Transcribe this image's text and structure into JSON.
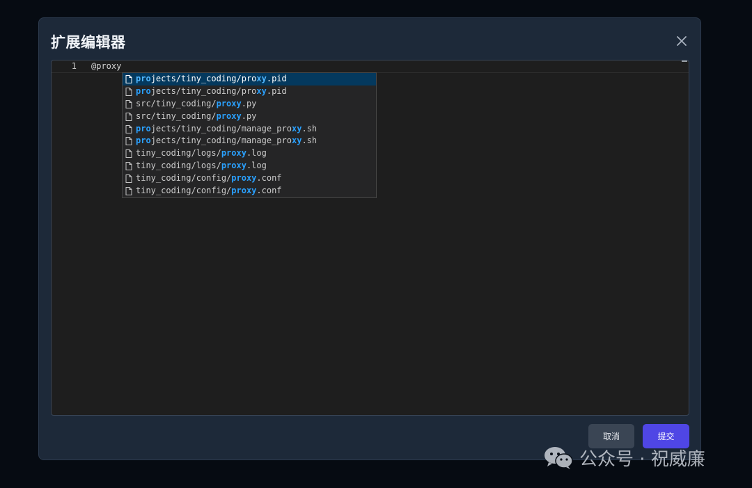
{
  "dialog": {
    "title": "扩展编辑器",
    "close_icon": "close-icon"
  },
  "editor": {
    "line_number": "1",
    "code": "@proxy"
  },
  "suggestions": [
    {
      "parts": [
        {
          "t": "pro",
          "h": true
        },
        {
          "t": "jects/tiny_coding/pro",
          "h": false
        },
        {
          "t": "xy",
          "h": true
        },
        {
          "t": ".pid",
          "h": false
        }
      ],
      "selected": true
    },
    {
      "parts": [
        {
          "t": "pro",
          "h": true
        },
        {
          "t": "jects/tiny_coding/pro",
          "h": false
        },
        {
          "t": "xy",
          "h": true
        },
        {
          "t": ".pid",
          "h": false
        }
      ],
      "selected": false
    },
    {
      "parts": [
        {
          "t": "src/tiny_coding/",
          "h": false
        },
        {
          "t": "proxy",
          "h": true
        },
        {
          "t": ".py",
          "h": false
        }
      ],
      "selected": false
    },
    {
      "parts": [
        {
          "t": "src/tiny_coding/",
          "h": false
        },
        {
          "t": "proxy",
          "h": true
        },
        {
          "t": ".py",
          "h": false
        }
      ],
      "selected": false
    },
    {
      "parts": [
        {
          "t": "pro",
          "h": true
        },
        {
          "t": "jects/tiny_coding/manage_pro",
          "h": false
        },
        {
          "t": "xy",
          "h": true
        },
        {
          "t": ".sh",
          "h": false
        }
      ],
      "selected": false
    },
    {
      "parts": [
        {
          "t": "pro",
          "h": true
        },
        {
          "t": "jects/tiny_coding/manage_pro",
          "h": false
        },
        {
          "t": "xy",
          "h": true
        },
        {
          "t": ".sh",
          "h": false
        }
      ],
      "selected": false
    },
    {
      "parts": [
        {
          "t": "tiny_coding/logs/",
          "h": false
        },
        {
          "t": "proxy",
          "h": true
        },
        {
          "t": ".log",
          "h": false
        }
      ],
      "selected": false
    },
    {
      "parts": [
        {
          "t": "tiny_coding/logs/",
          "h": false
        },
        {
          "t": "proxy",
          "h": true
        },
        {
          "t": ".log",
          "h": false
        }
      ],
      "selected": false
    },
    {
      "parts": [
        {
          "t": "tiny_coding/config/",
          "h": false
        },
        {
          "t": "proxy",
          "h": true
        },
        {
          "t": ".conf",
          "h": false
        }
      ],
      "selected": false
    },
    {
      "parts": [
        {
          "t": "tiny_coding/config/",
          "h": false
        },
        {
          "t": "proxy",
          "h": true
        },
        {
          "t": ".conf",
          "h": false
        }
      ],
      "selected": false
    }
  ],
  "suggestion_icon": "file-icon",
  "buttons": {
    "cancel_label": "取消",
    "submit_label": "提交"
  },
  "watermark": {
    "text": "公众号 · 祝威廉",
    "icon": "wechat-icon"
  },
  "colors": {
    "dialog_bg": "#1d2939",
    "editor_bg": "#1e1e1e",
    "highlight": "#2aa1ff",
    "selected_row": "#04395e",
    "submit_button": "#4f46e5",
    "cancel_button": "#3a4554"
  }
}
